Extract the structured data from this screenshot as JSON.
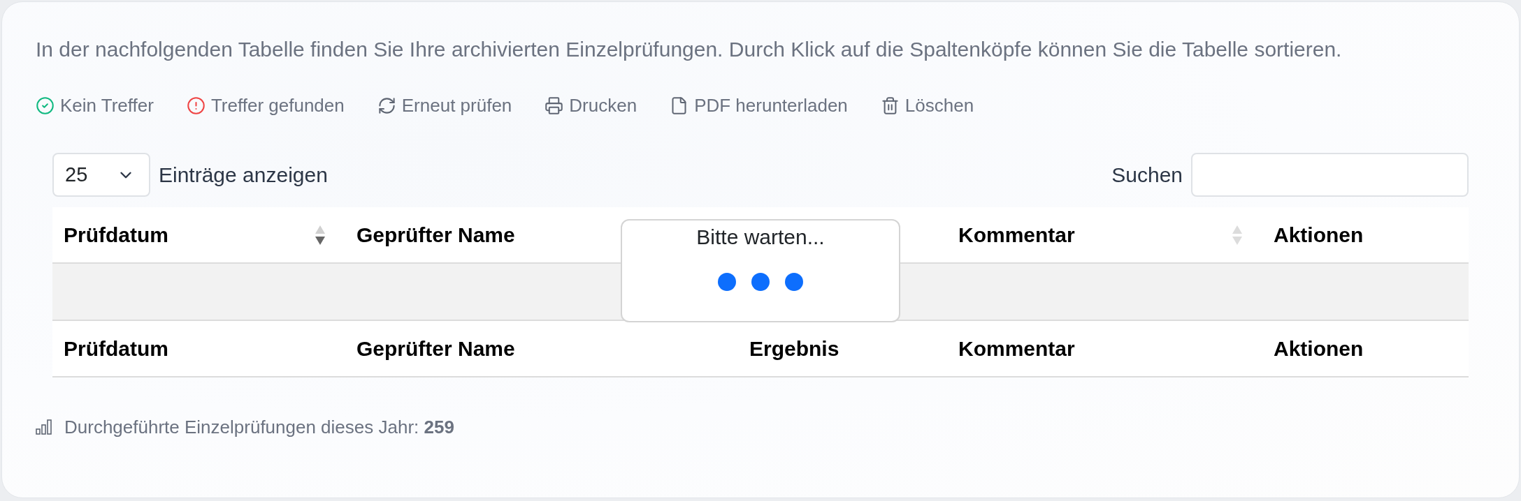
{
  "intro": "In der nachfolgenden Tabelle finden Sie Ihre archivierten Einzelprüfungen. Durch Klick auf die Spaltenköpfe können Sie die Tabelle sortieren.",
  "toolbar": [
    {
      "kind": "check",
      "label": "Kein Treffer",
      "color": "#10b981"
    },
    {
      "kind": "alert",
      "label": "Treffer gefunden",
      "color": "#ef4444"
    },
    {
      "kind": "refresh",
      "label": "Erneut prüfen",
      "color": "#5f6673"
    },
    {
      "kind": "print",
      "label": "Drucken",
      "color": "#5f6673"
    },
    {
      "kind": "pdf",
      "label": "PDF herunterladen",
      "color": "#5f6673"
    },
    {
      "kind": "delete",
      "label": "Löschen",
      "color": "#5f6673"
    }
  ],
  "length_menu": {
    "value": "25",
    "label": "Einträge anzeigen"
  },
  "search": {
    "label": "Suchen"
  },
  "table": {
    "columns": [
      {
        "label": "Prüfdatum",
        "sortable": true,
        "sorted_descending": true
      },
      {
        "label": "Geprüfter Name"
      },
      {},
      {
        "label": "Kommentar",
        "sortable": true,
        "sorted_descending": false
      },
      {
        "label": "Aktionen"
      }
    ],
    "footer": [
      "Prüfdatum",
      "Geprüfter Name",
      "Ergebnis",
      "Kommentar",
      "Aktionen"
    ]
  },
  "processing": {
    "text": "Bitte warten..."
  },
  "stats": "Durchgeführte Einzelprüfungen dieses Jahr: **259**"
}
